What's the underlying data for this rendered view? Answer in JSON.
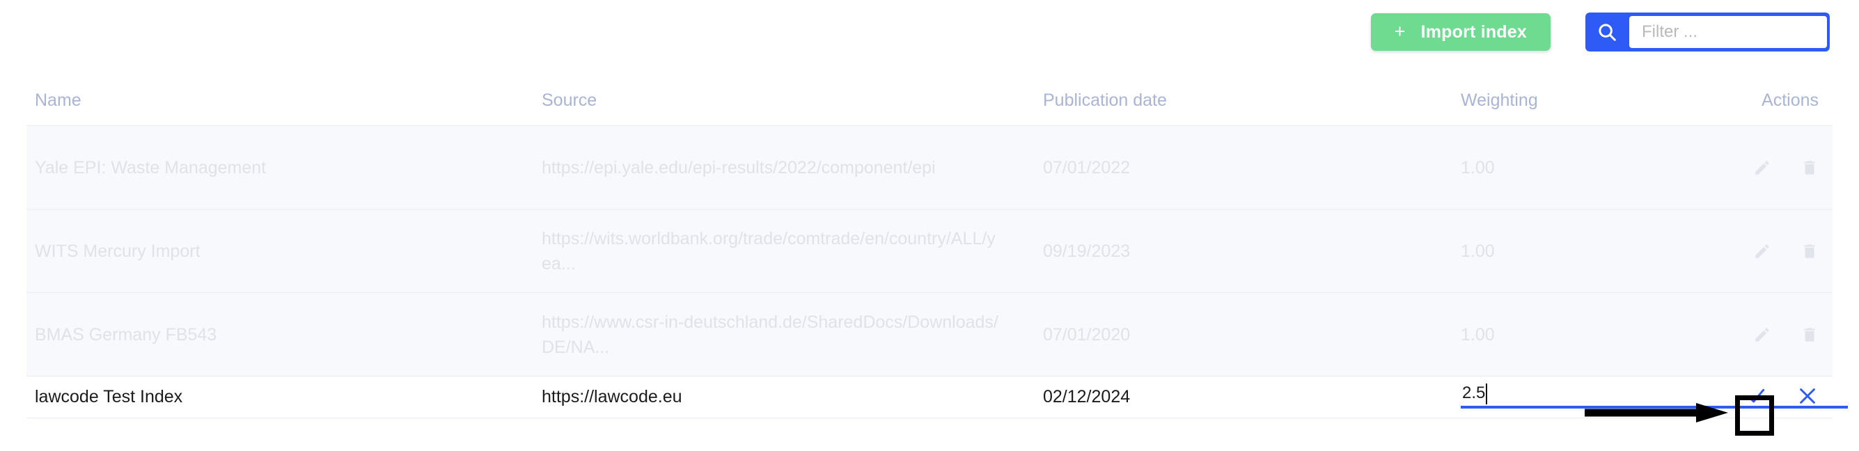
{
  "toolbar": {
    "import_label": "Import index",
    "import_plus": "+",
    "import_color": "#6fdb90",
    "search_icon": "search-icon",
    "search_button_color": "#2e5bf6",
    "filter_placeholder": "Filter ...",
    "filter_value": ""
  },
  "table": {
    "columns": [
      {
        "key": "name",
        "label": "Name"
      },
      {
        "key": "source",
        "label": "Source"
      },
      {
        "key": "date",
        "label": "Publication date"
      },
      {
        "key": "weighting",
        "label": "Weighting"
      },
      {
        "key": "actions",
        "label": "Actions"
      }
    ],
    "rows": [
      {
        "name": "Yale EPI: Waste Management",
        "source": "https://epi.yale.edu/epi-results/2022/component/epi",
        "date": "07/01/2022",
        "weighting": "1.00",
        "state": "muted",
        "actions": [
          "edit-icon",
          "delete-icon"
        ]
      },
      {
        "name": "WITS Mercury Import",
        "source": "https://wits.worldbank.org/trade/comtrade/en/country/ALL/yea...",
        "date": "09/19/2023",
        "weighting": "1.00",
        "state": "muted",
        "actions": [
          "edit-icon",
          "delete-icon"
        ]
      },
      {
        "name": "BMAS Germany FB543",
        "source": "https://www.csr-in-deutschland.de/SharedDocs/Downloads/DE/NA...",
        "date": "07/01/2020",
        "weighting": "1.00",
        "state": "muted",
        "actions": [
          "edit-icon",
          "delete-icon"
        ]
      },
      {
        "name": "lawcode Test Index",
        "source": "https://lawcode.eu",
        "date": "02/12/2024",
        "weighting": "2.5",
        "state": "editing",
        "actions": [
          "confirm-icon",
          "cancel-icon"
        ]
      }
    ]
  },
  "editor": {
    "weight_value": "2.5",
    "weight_placeholder": "",
    "underline_color": "#2e5bf6",
    "confirm_icon": "check-icon",
    "cancel_icon": "close-icon",
    "accent_color": "#2e5bf6"
  },
  "annotation": {
    "arrow": "right-arrow-annotation",
    "highlight_box": "confirm-button-highlight",
    "color": "#000000"
  }
}
